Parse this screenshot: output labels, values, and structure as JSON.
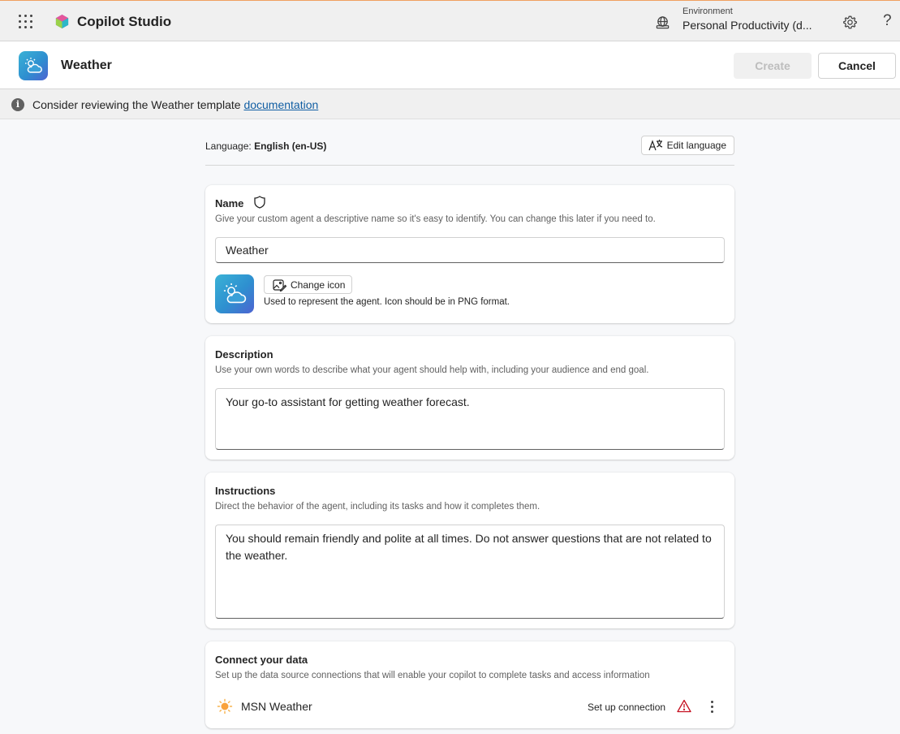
{
  "app": {
    "title": "Copilot Studio"
  },
  "environment": {
    "label": "Environment",
    "value": "Personal Productivity (d..."
  },
  "header": {
    "title": "Weather",
    "create_label": "Create",
    "cancel_label": "Cancel"
  },
  "info_bar": {
    "text": "Consider reviewing the Weather template ",
    "link_text": "documentation"
  },
  "language": {
    "prefix": "Language: ",
    "value": "English (en-US)",
    "edit_label": "Edit language"
  },
  "name_card": {
    "title": "Name",
    "subtitle": "Give your custom agent a descriptive name so it's easy to identify. You can change this later if you need to.",
    "value": "Weather",
    "change_icon_label": "Change icon",
    "icon_note": "Used to represent the agent. Icon should be in PNG format."
  },
  "description_card": {
    "title": "Description",
    "subtitle": "Use your own words to describe what your agent should help with, including your audience and end goal.",
    "value": "Your go-to assistant for getting weather forecast."
  },
  "instructions_card": {
    "title": "Instructions",
    "subtitle": "Direct the behavior of the agent, including its tasks and how it completes them.",
    "value": "You should remain friendly and polite at all times. Do not answer questions that are not related to the weather."
  },
  "data_card": {
    "title": "Connect your data",
    "subtitle": "Set up the data source connections that will enable your copilot to complete tasks and access information",
    "connections": [
      {
        "name": "MSN Weather",
        "action": "Set up connection",
        "icon": "sun-icon",
        "status_icon": "warning-icon"
      }
    ]
  },
  "colors": {
    "accent": "#115ea3",
    "warning": "#c50f1f",
    "tile_start": "#3ab2d6",
    "tile_end": "#4d63d1"
  }
}
